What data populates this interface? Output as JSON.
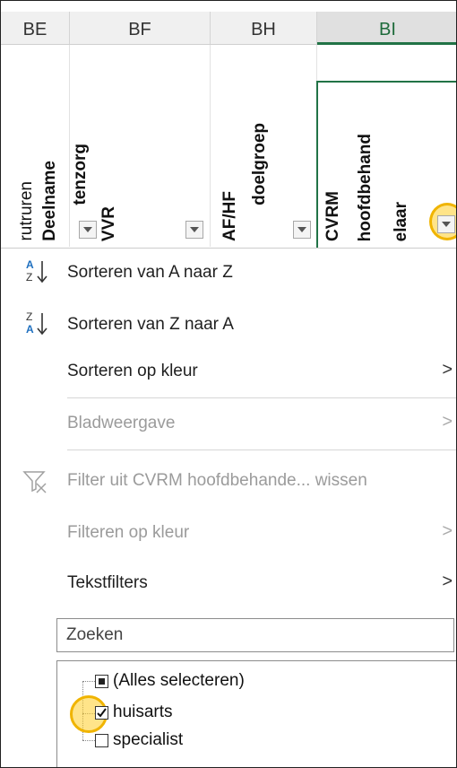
{
  "column_headers": [
    "BE",
    "BF",
    "BH",
    "BI"
  ],
  "field_headers": {
    "partial": "rutruren",
    "deelname": "Deelname",
    "tenzorg": "tenzorg",
    "vvr": "VVR",
    "afhf": "AF/HF",
    "doelgroep": "doelgroep",
    "cvrm": "CVRM",
    "hoofdbehand": "hoofdbehand",
    "elaar": "elaar"
  },
  "menu": {
    "sort_az": "Sorteren van A naar Z",
    "sort_za": "Sorteren van Z naar A",
    "sort_color": "Sorteren op kleur",
    "sheet_view": "Bladweergave",
    "clear_filter": "Filter uit CVRM hoofdbehande... wissen",
    "filter_color": "Filteren op kleur",
    "text_filters": "Tekstfilters",
    "chevron": ">"
  },
  "search": {
    "placeholder": "Zoeken"
  },
  "values": [
    {
      "label": "(Alles selecteren)",
      "state": "partial"
    },
    {
      "label": "huisarts",
      "state": "checked"
    },
    {
      "label": "specialist",
      "state": "unchecked"
    }
  ],
  "colors": {
    "excel_green": "#217346",
    "highlight": "#f0b400"
  }
}
